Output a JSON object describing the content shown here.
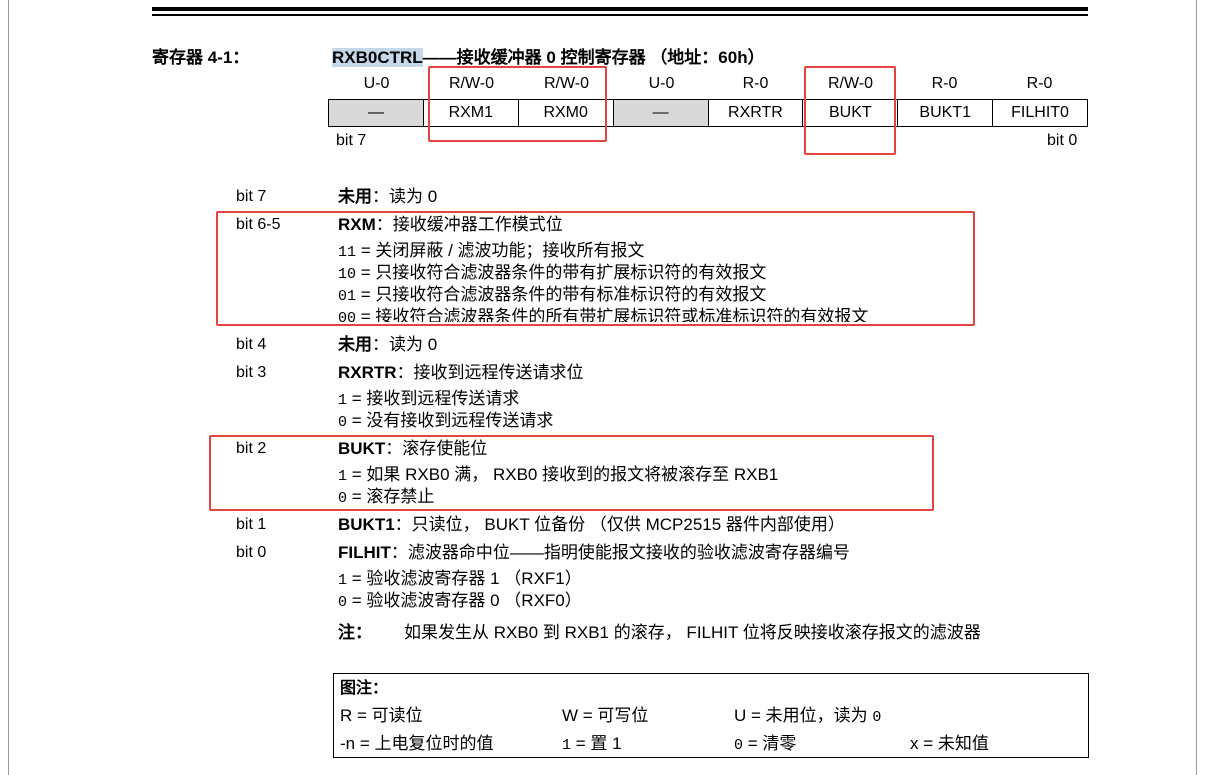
{
  "register": {
    "label": "寄存器 4-1：",
    "name": "RXB0CTRL",
    "title_rest": "——接收缓冲器 0 控制寄存器 （地址：60h）",
    "access": [
      "U-0",
      "R/W-0",
      "R/W-0",
      "U-0",
      "R-0",
      "R/W-0",
      "R-0",
      "R-0"
    ],
    "bits": [
      "—",
      "RXM1",
      "RXM0",
      "—",
      "RXRTR",
      "BUKT",
      "BUKT1",
      "FILHIT0"
    ],
    "bit_left": "bit 7",
    "bit_right": "bit 0"
  },
  "descriptions": {
    "bit7": {
      "num": "bit 7",
      "name": "未用",
      "text": "：读为 0"
    },
    "bit65": {
      "num": "bit 6-5",
      "name": "RXM",
      "text": "：接收缓冲器工作模式位",
      "options": [
        {
          "code": "11",
          "text": " = 关闭屏蔽 / 滤波功能；接收所有报文"
        },
        {
          "code": "10",
          "text": " = 只接收符合滤波器条件的带有扩展标识符的有效报文"
        },
        {
          "code": "01",
          "text": " = 只接收符合滤波器条件的带有标准标识符的有效报文"
        },
        {
          "code": "00",
          "text": " = 接收符合滤波器条件的所有带扩展标识符或标准标识符的有效报文"
        }
      ]
    },
    "bit4": {
      "num": "bit 4",
      "name": "未用",
      "text": "：读为 0"
    },
    "bit3": {
      "num": "bit 3",
      "name": "RXRTR",
      "text": "：接收到远程传送请求位",
      "options": [
        {
          "code": "1",
          "text": " =  接收到远程传送请求"
        },
        {
          "code": "0",
          "text": " =  没有接收到远程传送请求"
        }
      ]
    },
    "bit2": {
      "num": "bit 2",
      "name": "BUKT",
      "text": "：滚存使能位",
      "options": [
        {
          "code": "1",
          "text": " =  如果 RXB0 满， RXB0 接收到的报文将被滚存至 RXB1"
        },
        {
          "code": "0",
          "text": " =  滚存禁止"
        }
      ]
    },
    "bit1": {
      "num": "bit 1",
      "name": "BUKT1",
      "text": "：只读位， BUKT 位备份 （仅供 MCP2515 器件内部使用）"
    },
    "bit0": {
      "num": "bit 0",
      "name": "FILHIT",
      "text": "：滤波器命中位——指明使能报文接收的验收滤波寄存器编号",
      "options": [
        {
          "code": "1",
          "text": " =  验收滤波寄存器 1 （RXF1）"
        },
        {
          "code": "0",
          "text": " =  验收滤波寄存器 0 （RXF0）"
        }
      ]
    }
  },
  "note": {
    "label": "注：",
    "text": "如果发生从 RXB0 到 RXB1 的滚存， FILHIT 位将反映接收滚存报文的滤波器"
  },
  "legend": {
    "title": "图注：",
    "row1": [
      "R = 可读位",
      "W = 可写位",
      "U = 未用位，读为 ",
      "0"
    ],
    "row2": [
      "-n = 上电复位时的值",
      "1",
      " = 置 1",
      "0",
      " = 清零",
      "x = 未知值"
    ]
  },
  "colors": {
    "highlight_box": "#e2443f",
    "name_highlight": "#c5d8ea",
    "shaded_cell": "#d9d9d9"
  }
}
